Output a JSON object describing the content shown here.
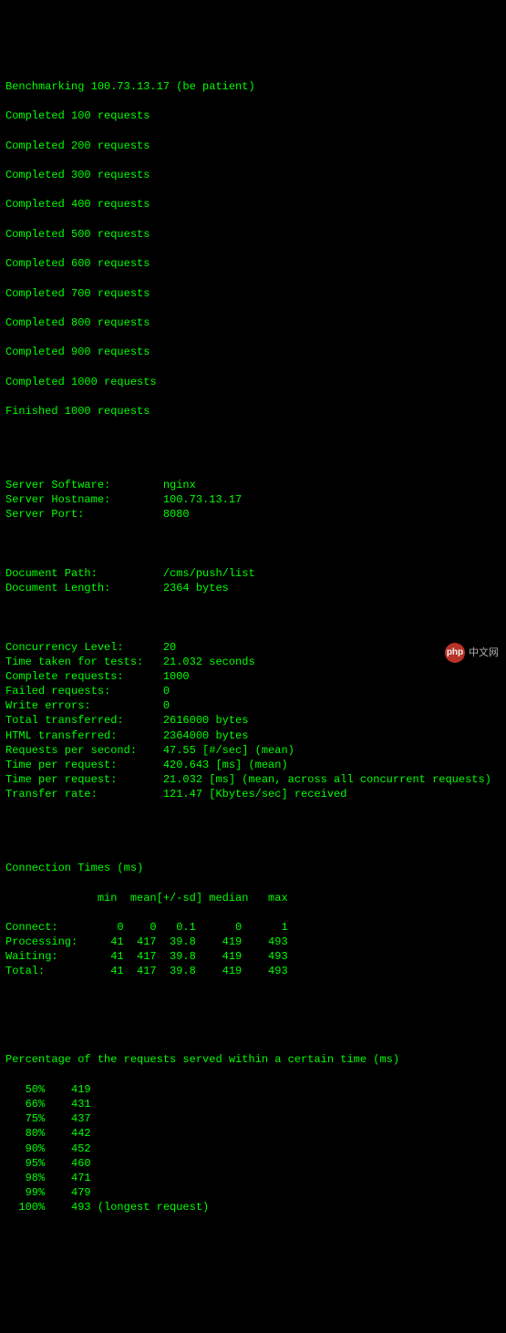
{
  "progress": {
    "header": "Benchmarking 100.73.13.17 (be patient)",
    "lines": [
      "Completed 100 requests",
      "Completed 200 requests",
      "Completed 300 requests",
      "Completed 400 requests",
      "Completed 500 requests",
      "Completed 600 requests",
      "Completed 700 requests",
      "Completed 800 requests",
      "Completed 900 requests",
      "Completed 1000 requests",
      "Finished 1000 requests"
    ]
  },
  "server_info": [
    {
      "label": "Server Software:",
      "value": "nginx"
    },
    {
      "label": "Server Hostname:",
      "value": "100.73.13.17"
    },
    {
      "label": "Server Port:",
      "value": "8080"
    }
  ],
  "document_info": [
    {
      "label": "Document Path:",
      "value": "/cms/push/list"
    },
    {
      "label": "Document Length:",
      "value": "2364 bytes"
    }
  ],
  "metrics": [
    {
      "label": "Concurrency Level:",
      "value": "20"
    },
    {
      "label": "Time taken for tests:",
      "value": "21.032 seconds"
    },
    {
      "label": "Complete requests:",
      "value": "1000"
    },
    {
      "label": "Failed requests:",
      "value": "0"
    },
    {
      "label": "Write errors:",
      "value": "0"
    },
    {
      "label": "Total transferred:",
      "value": "2616000 bytes"
    },
    {
      "label": "HTML transferred:",
      "value": "2364000 bytes"
    },
    {
      "label": "Requests per second:",
      "value": "47.55 [#/sec] (mean)"
    },
    {
      "label": "Time per request:",
      "value": "420.643 [ms] (mean)"
    },
    {
      "label": "Time per request:",
      "value": "21.032 [ms] (mean, across all concurrent requests)"
    },
    {
      "label": "Transfer rate:",
      "value": "121.47 [Kbytes/sec] received"
    }
  ],
  "connection_times": {
    "title": "Connection Times (ms)",
    "header": "              min  mean[+/-sd] median   max",
    "rows": [
      {
        "name": "Connect:",
        "min": "0",
        "mean": "0",
        "sd": "0.1",
        "median": "0",
        "max": "1"
      },
      {
        "name": "Processing:",
        "min": "41",
        "mean": "417",
        "sd": "39.8",
        "median": "419",
        "max": "493"
      },
      {
        "name": "Waiting:",
        "min": "41",
        "mean": "417",
        "sd": "39.8",
        "median": "419",
        "max": "493"
      },
      {
        "name": "Total:",
        "min": "41",
        "mean": "417",
        "sd": "39.8",
        "median": "419",
        "max": "493"
      }
    ]
  },
  "percentiles": {
    "title": "Percentage of the requests served within a certain time (ms)",
    "rows": [
      {
        "pct": "50%",
        "val": "419",
        "note": ""
      },
      {
        "pct": "66%",
        "val": "431",
        "note": ""
      },
      {
        "pct": "75%",
        "val": "437",
        "note": ""
      },
      {
        "pct": "80%",
        "val": "442",
        "note": ""
      },
      {
        "pct": "90%",
        "val": "452",
        "note": ""
      },
      {
        "pct": "95%",
        "val": "460",
        "note": ""
      },
      {
        "pct": "98%",
        "val": "471",
        "note": ""
      },
      {
        "pct": "99%",
        "val": "479",
        "note": ""
      },
      {
        "pct": "100%",
        "val": "493",
        "note": " (longest request)"
      }
    ]
  },
  "watermark": {
    "badge": "php",
    "text": "中文网"
  }
}
